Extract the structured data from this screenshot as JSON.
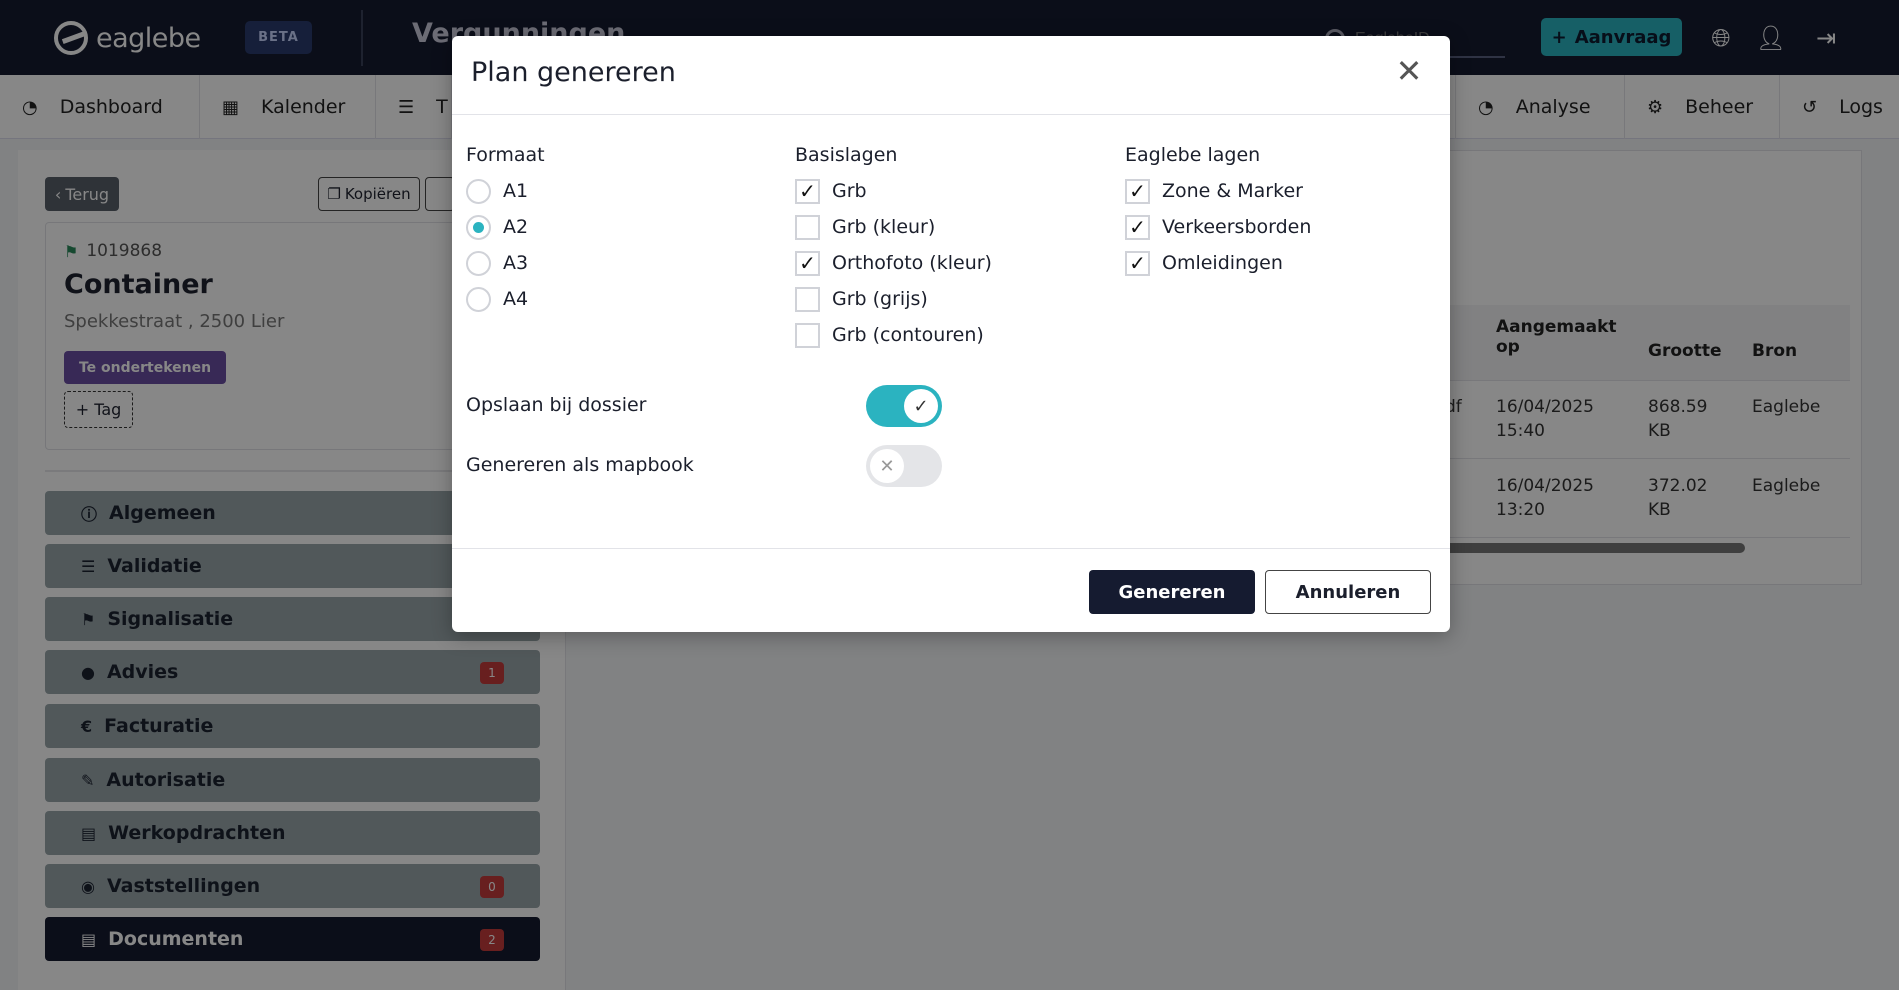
{
  "app": {
    "logo_text": "eaglebe",
    "beta_label": "BETA",
    "page_heading": "Vergunningen",
    "search_placeholder": "EaglebeID",
    "request_button": "Aanvraag"
  },
  "nav": [
    {
      "label": "Dashboard",
      "icon": "dashboard-icon"
    },
    {
      "label": "Kalender",
      "icon": "calendar-icon"
    },
    {
      "label": "T",
      "icon": "tasks-icon"
    },
    {
      "label": "Analyse",
      "icon": "analyse-icon"
    },
    {
      "label": "Beheer",
      "icon": "gears-icon"
    },
    {
      "label": "Logs",
      "icon": "history-icon"
    }
  ],
  "detail": {
    "back_label": "Terug",
    "copy_label": "Kopiëren",
    "number": "1019868",
    "title": "Container",
    "address": "Spekkestraat , 2500 Lier",
    "status": "Te ondertekenen",
    "tag_label": "+ Tag"
  },
  "sidebar": [
    {
      "label": "Algemeen",
      "icon": "info-icon",
      "count": ""
    },
    {
      "label": "Validatie",
      "icon": "checklist-icon",
      "count": ""
    },
    {
      "label": "Signalisatie",
      "icon": "signpost-icon",
      "count": ""
    },
    {
      "label": "Advies",
      "icon": "comment-icon",
      "count": "1"
    },
    {
      "label": "Facturatie",
      "icon": "euro-icon",
      "count": ""
    },
    {
      "label": "Autorisatie",
      "icon": "file-signature-icon",
      "count": ""
    },
    {
      "label": "Werkopdrachten",
      "icon": "file-icon",
      "count": ""
    },
    {
      "label": "Vaststellingen",
      "icon": "eye-icon",
      "count": "0"
    },
    {
      "label": "Documenten",
      "icon": "file-icon",
      "count": "2"
    }
  ],
  "documents": {
    "columns": [
      "Aangemaakt op",
      "Grootte",
      "Bron"
    ],
    "rows": [
      {
        "ext": "df",
        "created": "16/04/2025 15:40",
        "size": "868.59 KB",
        "source": "Eaglebe"
      },
      {
        "ext": "",
        "created": "16/04/2025 13:20",
        "size": "372.02 KB",
        "source": "Eaglebe"
      }
    ]
  },
  "modal": {
    "title": "Plan genereren",
    "format": {
      "label": "Formaat",
      "options": [
        "A1",
        "A2",
        "A3",
        "A4"
      ],
      "selected": "A2"
    },
    "base_layers": {
      "label": "Basislagen",
      "items": [
        {
          "label": "Grb",
          "checked": true
        },
        {
          "label": "Grb (kleur)",
          "checked": false
        },
        {
          "label": "Orthofoto (kleur)",
          "checked": true
        },
        {
          "label": "Grb (grijs)",
          "checked": false
        },
        {
          "label": "Grb (contouren)",
          "checked": false
        }
      ]
    },
    "eaglebe_layers": {
      "label": "Eaglebe lagen",
      "items": [
        {
          "label": "Zone & Marker",
          "checked": true
        },
        {
          "label": "Verkeersborden",
          "checked": true
        },
        {
          "label": "Omleidingen",
          "checked": true
        }
      ]
    },
    "save_to_file": {
      "label": "Opslaan bij dossier",
      "on": true
    },
    "as_mapbook": {
      "label": "Genereren als mapbook",
      "on": false
    },
    "generate_button": "Genereren",
    "cancel_button": "Annuleren"
  },
  "colors": {
    "navy": "#151b30",
    "accent": "#2bb3c0",
    "status_purple": "#6b4fa3",
    "count_red": "#c43c3c"
  }
}
